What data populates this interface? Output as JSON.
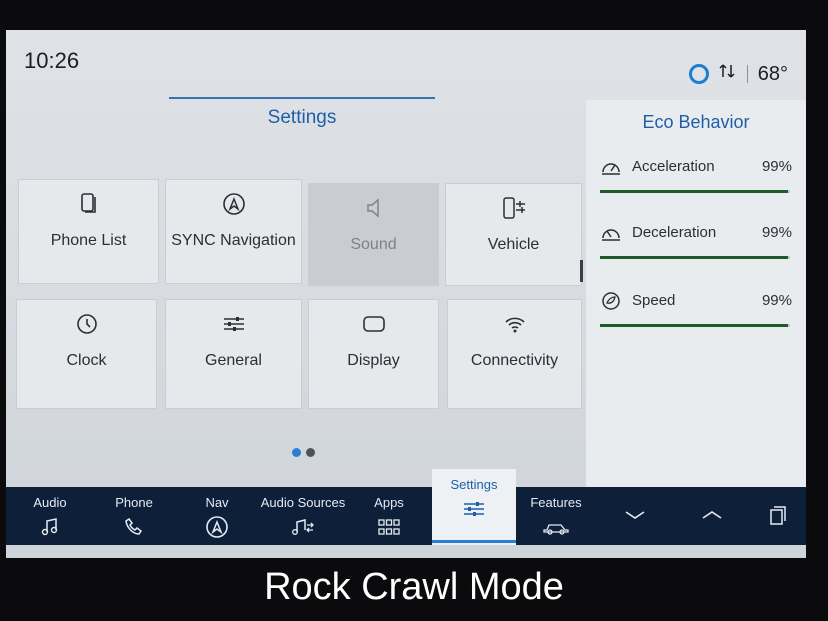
{
  "status": {
    "time": "10:26",
    "temperature": "68°"
  },
  "page": {
    "title": "Settings"
  },
  "tiles": [
    {
      "label": "Phone List",
      "icon": "phone-list-icon",
      "disabled": false
    },
    {
      "label": "SYNC Navigation",
      "icon": "navigation-icon",
      "disabled": false
    },
    {
      "label": "Sound",
      "icon": "speaker-icon",
      "disabled": true
    },
    {
      "label": "Vehicle",
      "icon": "vehicle-settings-icon",
      "disabled": false
    },
    {
      "label": "Clock",
      "icon": "clock-icon",
      "disabled": false
    },
    {
      "label": "General",
      "icon": "sliders-icon",
      "disabled": false
    },
    {
      "label": "Display",
      "icon": "display-icon",
      "disabled": false
    },
    {
      "label": "Connectivity",
      "icon": "wifi-icon",
      "disabled": false
    }
  ],
  "pager": {
    "pages": 2,
    "current": 1
  },
  "eco": {
    "title": "Eco Behavior",
    "rows": [
      {
        "name": "Acceleration",
        "value": "99%",
        "level": 0.99,
        "icon": "acceleration-gauge-icon"
      },
      {
        "name": "Deceleration",
        "value": "99%",
        "level": 0.99,
        "icon": "deceleration-gauge-icon"
      },
      {
        "name": "Speed",
        "value": "99%",
        "level": 0.99,
        "icon": "speed-leaf-icon"
      }
    ]
  },
  "bottom_nav": {
    "audio": "Audio",
    "phone": "Phone",
    "nav": "Nav",
    "audio_sources": "Audio Sources",
    "apps": "Apps",
    "settings": "Settings",
    "features": "Features"
  },
  "caption": "Rock Crawl Mode",
  "colors": {
    "accent": "#2a7fd4",
    "nav_bar": "#0e1f3a",
    "eco_bar": "#1f5a2a"
  }
}
